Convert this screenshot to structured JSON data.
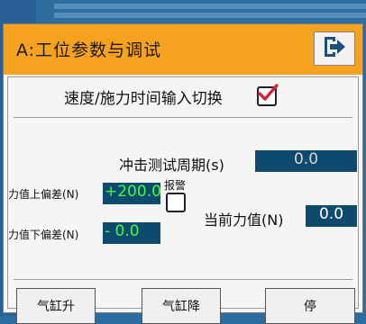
{
  "window": {
    "title": "A:工位参数与调试"
  },
  "toggle": {
    "label": "速度/施力时间输入切换",
    "checked": true
  },
  "impact_test": {
    "label": "冲击测试周期(s)",
    "value": "0.0"
  },
  "force_upper": {
    "label": "力值上偏差(N)",
    "value": "+200.0"
  },
  "force_lower": {
    "label": "力值下偏差(N)",
    "value": "-  0.0"
  },
  "alarm": {
    "label": "报警",
    "checked": false
  },
  "current_force": {
    "label": "当前力值(N)",
    "value": "0.0"
  },
  "buttons": {
    "cylinder_up": "气缸升",
    "cylinder_down": "气缸降",
    "stop": "停"
  },
  "colors": {
    "title_bar": "#f7a21f",
    "value_box": "#0d4a6e",
    "green_text": "#3cff3c",
    "check_mark": "#d6213b"
  },
  "icons": {
    "exit": "exit-icon",
    "check": "checkmark-icon"
  }
}
